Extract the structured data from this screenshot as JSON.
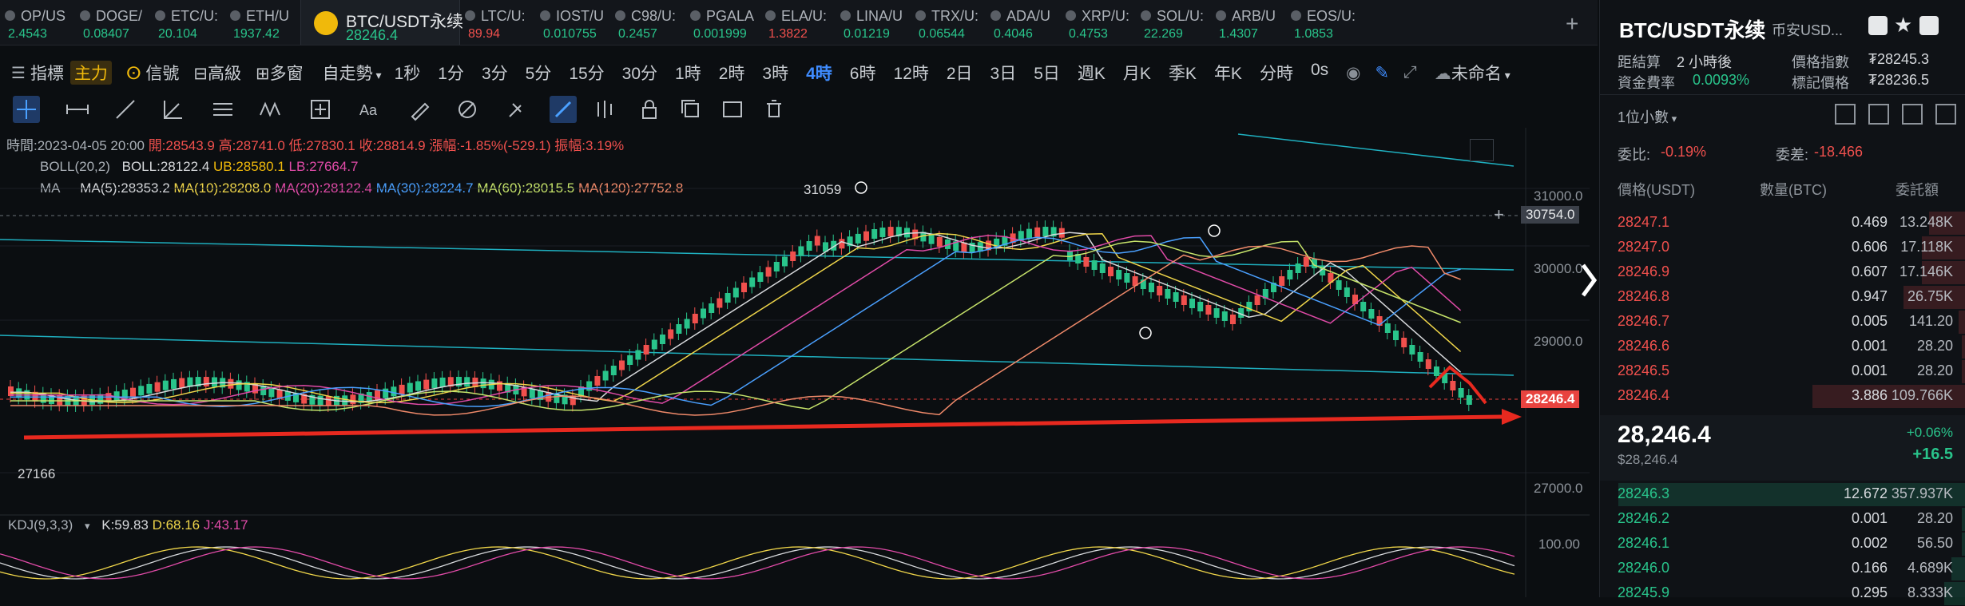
{
  "tabs": [
    {
      "name": "OP/US",
      "price": "2.4543",
      "dir": "up"
    },
    {
      "name": "DOGE/",
      "price": "0.08407",
      "dir": "up"
    },
    {
      "name": "ETC/U:",
      "price": "20.104",
      "dir": "up"
    },
    {
      "name": "ETH/U",
      "price": "1937.42",
      "dir": "up"
    },
    {
      "name": "BTC/USDT永续",
      "price": "28246.4",
      "dir": "up",
      "active": true
    },
    {
      "name": "LTC/U:",
      "price": "89.94",
      "dir": "down"
    },
    {
      "name": "IOST/U",
      "price": "0.010755",
      "dir": "up"
    },
    {
      "name": "C98/U:",
      "price": "0.2457",
      "dir": "up"
    },
    {
      "name": "PGALA",
      "price": "0.001999",
      "dir": "up"
    },
    {
      "name": "ELA/U:",
      "price": "1.3822",
      "dir": "down"
    },
    {
      "name": "LINA/U",
      "price": "0.01219",
      "dir": "up"
    },
    {
      "name": "TRX/U:",
      "price": "0.06544",
      "dir": "up"
    },
    {
      "name": "ADA/U",
      "price": "0.4046",
      "dir": "up"
    },
    {
      "name": "XRP/U:",
      "price": "0.4753",
      "dir": "up"
    },
    {
      "name": "SOL/U:",
      "price": "22.269",
      "dir": "up"
    },
    {
      "name": "ARB/U",
      "price": "1.4307",
      "dir": "up"
    },
    {
      "name": "EOS/U:",
      "price": "1.0853",
      "dir": "up"
    }
  ],
  "toolbar": {
    "indicators": "指標",
    "main": "主力",
    "signals": "信號",
    "advanced": "高級",
    "multi": "多窗",
    "auto": "自走勢",
    "intervals": [
      "1秒",
      "1分",
      "3分",
      "5分",
      "15分",
      "30分",
      "1時",
      "2時",
      "3時",
      "4時",
      "6時",
      "12時",
      "2日",
      "3日",
      "5日",
      "週K",
      "月K",
      "季K",
      "年K",
      "分時",
      "0s"
    ],
    "active_interval": "4時",
    "layout_name": "未命名"
  },
  "ohlc": {
    "time": "時間:2023-04-05 20:00",
    "open": "開:28543.9",
    "high": "高:28741.0",
    "low": "低:27830.1",
    "close": "收:28814.9",
    "change": "漲幅:-1.85%(-529.1)",
    "amplitude": "振幅:3.19%"
  },
  "boll": {
    "label": "BOLL(20,2)",
    "mid": "BOLL:28122.4",
    "ub": "UB:28580.1",
    "lb": "LB:27664.7"
  },
  "ma": {
    "label": "MA",
    "ma5": "MA(5):28353.2",
    "ma10": "MA(10):28208.0",
    "ma20": "MA(20):28122.4",
    "ma30": "MA(30):28224.7",
    "ma60": "MA(60):28015.5",
    "ma120": "MA(120):27752.8"
  },
  "kdj": {
    "label": "KDJ(9,3,3)",
    "k": "K:59.83",
    "d": "D:68.16",
    "j": "J:43.17"
  },
  "price_axis": {
    "p31000": "31000.0",
    "p30000": "30000.0",
    "p29000": "29000.0",
    "p27000": "27000.0",
    "kdj100": "100.00"
  },
  "chart_labels": {
    "high_mark": "31059",
    "low_mark": "27166",
    "crosshair_price": "30754.0",
    "last_price_tag": "28246.4"
  },
  "colors": {
    "up": "#29c48b",
    "down": "#f0504d",
    "accent": "#3f8cff",
    "brand": "#f0b90b"
  },
  "panel": {
    "title": "BTC/USDT永续",
    "exchange": "币安USD...",
    "funding_label": "距結算",
    "funding_value": "2 小時後",
    "rate_label": "資金費率",
    "rate_value": "0.0093%",
    "index_label": "價格指數",
    "index_value": "₮28245.3",
    "mark_label": "標記價格",
    "mark_value": "₮28236.5",
    "precision": "1位小數",
    "ratio_label": "委比:",
    "ratio_value": "-0.19%",
    "diff_label": "委差:",
    "diff_value": "-18.466",
    "col_price": "價格(USDT)",
    "col_qty": "數量(BTC)",
    "col_total": "委託額",
    "asks": [
      {
        "p": "28247.1",
        "q": "0.469",
        "t": "13.248K",
        "w": 0.1
      },
      {
        "p": "28247.0",
        "q": "0.606",
        "t": "17.118K",
        "w": 0.12
      },
      {
        "p": "28246.9",
        "q": "0.607",
        "t": "17.146K",
        "w": 0.12
      },
      {
        "p": "28246.8",
        "q": "0.947",
        "t": "26.75K",
        "w": 0.17
      },
      {
        "p": "28246.7",
        "q": "0.005",
        "t": "141.20",
        "w": 0.02
      },
      {
        "p": "28246.6",
        "q": "0.001",
        "t": "28.20",
        "w": 0.01
      },
      {
        "p": "28246.5",
        "q": "0.001",
        "t": "28.20",
        "w": 0.01
      },
      {
        "p": "28246.4",
        "q": "3.886",
        "t": "109.766K",
        "w": 0.42
      }
    ],
    "last_price": "28,246.4",
    "last_usd": "$28,246.4",
    "change_pct": "+0.06%",
    "change_abs": "+16.5",
    "bids": [
      {
        "p": "28246.3",
        "q": "12.672",
        "t": "357.937K",
        "w": 0.95
      },
      {
        "p": "28246.2",
        "q": "0.001",
        "t": "28.20",
        "w": 0.01
      },
      {
        "p": "28246.1",
        "q": "0.002",
        "t": "56.50",
        "w": 0.01
      },
      {
        "p": "28246.0",
        "q": "0.166",
        "t": "4.689K",
        "w": 0.04
      },
      {
        "p": "28245.9",
        "q": "0.295",
        "t": "8.333K",
        "w": 0.06
      }
    ]
  }
}
